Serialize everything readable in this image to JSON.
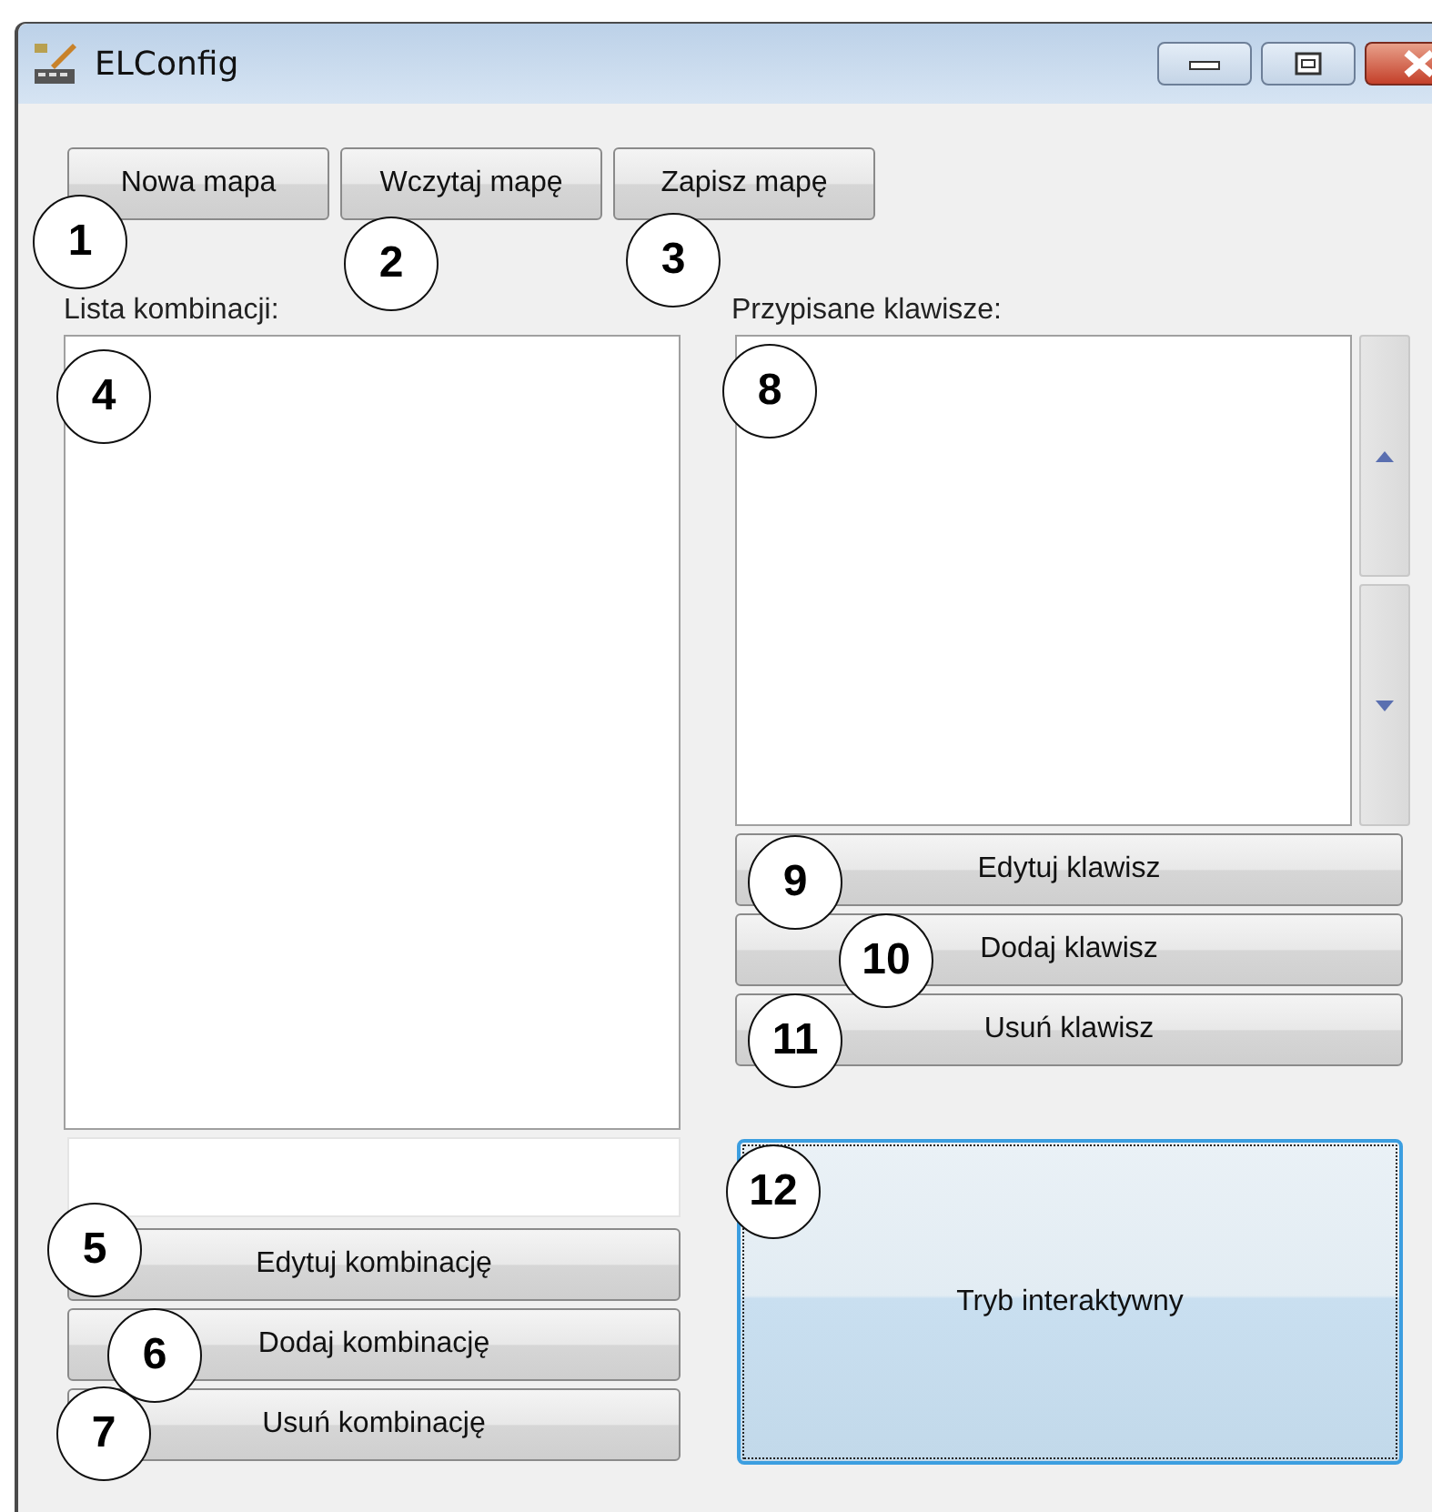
{
  "window": {
    "title": "ELConfig"
  },
  "toolbar": [
    {
      "label": "Nowa mapa"
    },
    {
      "label": "Wczytaj mapę"
    },
    {
      "label": "Zapisz mapę"
    }
  ],
  "combinations": {
    "label": "Lista kombinacji:",
    "buttons": [
      {
        "label": "Edytuj kombinację"
      },
      {
        "label": "Dodaj kombinację"
      },
      {
        "label": "Usuń kombinację"
      }
    ]
  },
  "keys": {
    "label": "Przypisane klawisze:",
    "buttons": [
      {
        "label": "Edytuj klawisz"
      },
      {
        "label": "Dodaj klawisz"
      },
      {
        "label": "Usuń klawisz"
      }
    ]
  },
  "interactive_button": {
    "label": "Tryb interaktywny",
    "focused": true
  },
  "callouts": [
    "1",
    "2",
    "3",
    "4",
    "5",
    "6",
    "7",
    "8",
    "9",
    "10",
    "11",
    "12"
  ]
}
